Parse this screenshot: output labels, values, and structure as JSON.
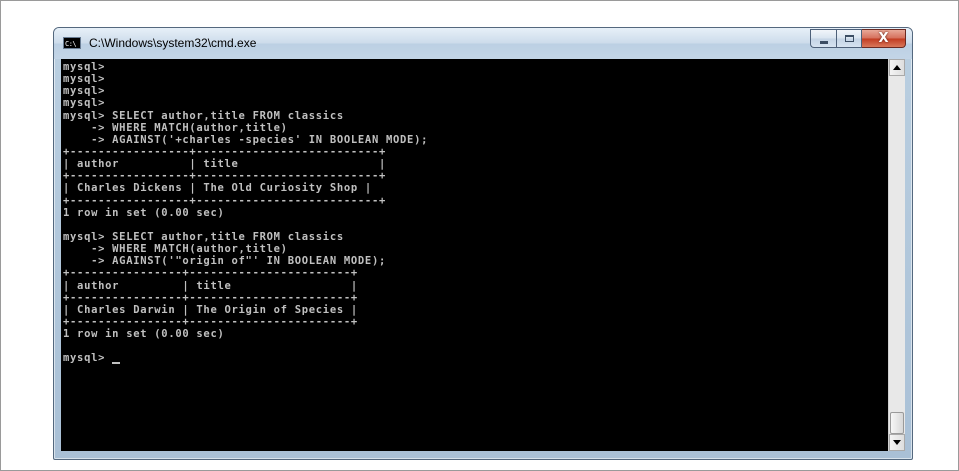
{
  "window": {
    "title": "C:\\Windows\\system32\\cmd.exe",
    "app_icon_text": "C:\\",
    "minimize_label": "minimize",
    "maximize_label": "maximize",
    "close_label": "X"
  },
  "console": {
    "lines": [
      "mysql>",
      "mysql>",
      "mysql>",
      "mysql>",
      "mysql> SELECT author,title FROM classics",
      "    -> WHERE MATCH(author,title)",
      "    -> AGAINST('+charles -species' IN BOOLEAN MODE);",
      "+-----------------+--------------------------+",
      "| author          | title                    |",
      "+-----------------+--------------------------+",
      "| Charles Dickens | The Old Curiosity Shop |",
      "+-----------------+--------------------------+",
      "1 row in set (0.00 sec)",
      "",
      "mysql> SELECT author,title FROM classics",
      "    -> WHERE MATCH(author,title)",
      "    -> AGAINST('\"origin of\"' IN BOOLEAN MODE);",
      "+----------------+-----------------------+",
      "| author         | title                 |",
      "+----------------+-----------------------+",
      "| Charles Darwin | The Origin of Species |",
      "+----------------+-----------------------+",
      "1 row in set (0.00 sec)",
      "",
      "mysql> "
    ],
    "text_color": "#c0c0c0",
    "background_color": "#000000"
  },
  "scrollbar": {
    "up_arrow": "arrow-up-icon",
    "down_arrow": "arrow-down-icon"
  }
}
